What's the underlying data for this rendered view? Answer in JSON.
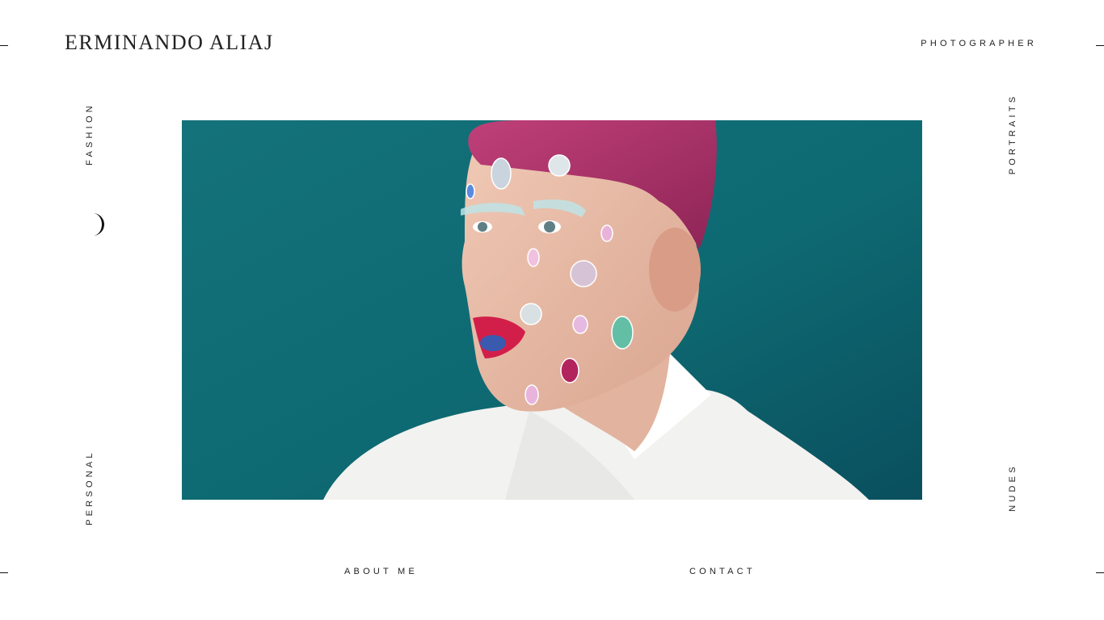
{
  "site": {
    "name": "ERMINANDO ALIAJ",
    "tagline": "PHOTOGRAPHER"
  },
  "nav": {
    "left_top": "FASHION",
    "left_bottom": "PERSONAL",
    "right_top": "PORTRAITS",
    "right_bottom": "NUDES",
    "bottom_left": "ABOUT ME",
    "bottom_right": "CONTACT"
  },
  "hero": {
    "subject": "portrait of a man with magenta hair and jewels on face",
    "background_color": "#0e6e74",
    "hair_color": "#b0356b",
    "lip_color": "#d21f4a",
    "shirt_color": "#f4f4f2"
  }
}
